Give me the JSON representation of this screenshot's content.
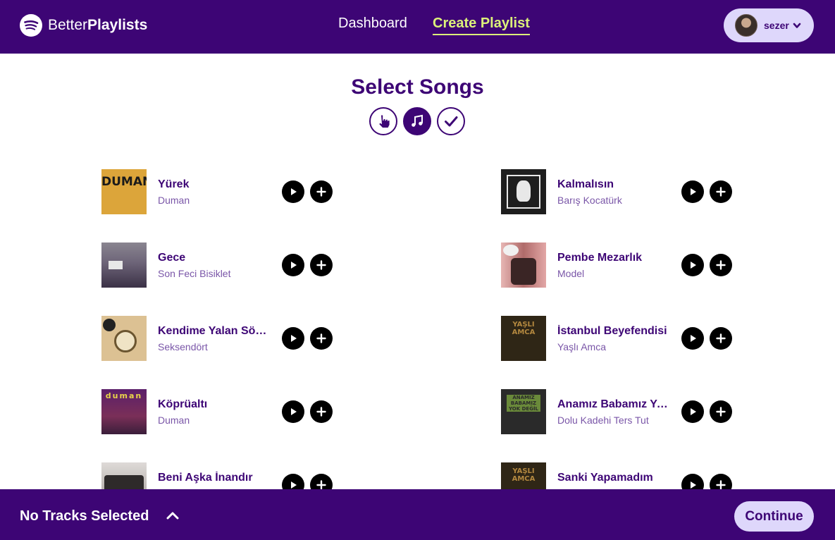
{
  "header": {
    "brand_light": "Better",
    "brand_bold": "Playlists",
    "nav": {
      "dashboard": "Dashboard",
      "create_playlist": "Create Playlist"
    },
    "user": {
      "name": "sezer"
    },
    "colors": {
      "bar": "#3d0575",
      "active_link": "#dcf27a",
      "pill": "#ded7fb"
    }
  },
  "main": {
    "title": "Select Songs",
    "steps": [
      {
        "icon": "pointer-hand-icon",
        "active": false
      },
      {
        "icon": "music-note-icon",
        "active": true
      },
      {
        "icon": "checkmark-icon",
        "active": false
      }
    ]
  },
  "tracks": [
    {
      "title": "Yürek",
      "artist": "Duman",
      "cover_text": "DUMAN",
      "cover_color": "#dca53a"
    },
    {
      "title": "Kalmalısın",
      "artist": "Barış Kocatürk",
      "cover_text": "",
      "cover_color": "#1e1e1e"
    },
    {
      "title": "Gece",
      "artist": "Son Feci Bisiklet",
      "cover_text": "",
      "cover_color": "#4f4258"
    },
    {
      "title": "Pembe Mezarlık",
      "artist": "Model",
      "cover_text": "",
      "cover_color": "#d69a9a"
    },
    {
      "title": "Kendime Yalan Söylemeden",
      "artist": "Seksendört",
      "cover_text": "",
      "cover_color": "#dcc193"
    },
    {
      "title": "İstanbul Beyefendisi",
      "artist": "Yaşlı Amca",
      "cover_text": "YAŞLI AMCA",
      "cover_color": "#2f2616"
    },
    {
      "title": "Köprüaltı",
      "artist": "Duman",
      "cover_text": "duman",
      "cover_color": "#6a2a58"
    },
    {
      "title": "Anamız Babamız Yok Değiliz",
      "artist": "Dolu Kadehi Ters Tut",
      "cover_text": "ANAMIZ BABAMIZ YOK DEĞİL",
      "cover_color": "#2a2a2a"
    },
    {
      "title": "Beni Aşka İnandır",
      "artist": "",
      "cover_text": "",
      "cover_color": "#c9c3c2"
    },
    {
      "title": "Sanki Yapamadım",
      "artist": "",
      "cover_text": "YAŞLI AMCA",
      "cover_color": "#2f2616"
    }
  ],
  "footer": {
    "selection_status": "No Tracks Selected",
    "continue_label": "Continue"
  }
}
